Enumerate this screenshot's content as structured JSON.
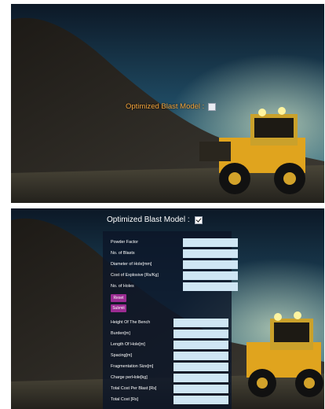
{
  "screen_top": {
    "toggle_label": "Optimized Blast Model :",
    "toggle_checked": false
  },
  "screen_bottom": {
    "toggle_label": "Optimized Blast Model :",
    "toggle_checked": true,
    "inputs": [
      {
        "label": "Powder Factor",
        "value": ""
      },
      {
        "label": "No. of Blasts",
        "value": ""
      },
      {
        "label": "Diameter of Hole[mm]",
        "value": ""
      },
      {
        "label": "Cost of Explosive [Rs/Kg]",
        "value": ""
      },
      {
        "label": "No. of Holes",
        "value": ""
      }
    ],
    "buttons": {
      "reset": "Reset",
      "submit": "Submit"
    },
    "outputs": [
      {
        "label": "Height Of The Bench",
        "value": ""
      },
      {
        "label": "Burden[m]",
        "value": ""
      },
      {
        "label": "Length Of Hole[m]",
        "value": ""
      },
      {
        "label": "Spacing[m]",
        "value": ""
      },
      {
        "label": "Fragmentation Size[m]",
        "value": ""
      },
      {
        "label": "Charge perHole[kg]",
        "value": ""
      },
      {
        "label": "Total Cost Per Blast [Rs]",
        "value": ""
      },
      {
        "label": "Total Cost [Rs]",
        "value": ""
      }
    ]
  },
  "colors": {
    "toggle_label": "#f2a33a",
    "form_bg": "#0c1628",
    "field_bg": "#cfe6f4",
    "button_bg": "#9b2c92"
  }
}
